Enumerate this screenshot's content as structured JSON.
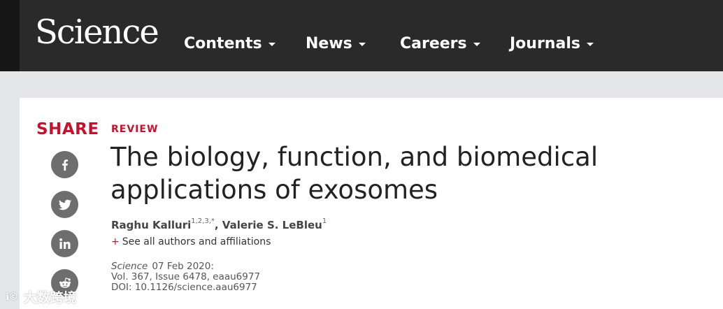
{
  "header": {
    "logo": "Science",
    "nav": [
      {
        "label": "Contents"
      },
      {
        "label": "News"
      },
      {
        "label": "Careers"
      },
      {
        "label": "Journals"
      }
    ]
  },
  "share": {
    "label": "SHARE",
    "buttons": [
      "facebook-icon",
      "twitter-icon",
      "linkedin-icon",
      "reddit-icon"
    ]
  },
  "article": {
    "type": "REVIEW",
    "title": "The biology, function, and biomedical applications of exosomes",
    "authors": [
      {
        "name": "Raghu Kalluri",
        "affiliations": "1,2,3,*",
        "separator": ", "
      },
      {
        "name": "Valerie S. LeBleu",
        "affiliations": "1",
        "separator": ""
      }
    ],
    "see_all_plus": "+",
    "see_all": "See all authors and affiliations",
    "journal": "Science",
    "date": "07 Feb 2020:",
    "volume": "Vol. 367, Issue 6478, eaau6977",
    "doi": "DOI: 10.1126/science.aau6977"
  },
  "watermark": {
    "logo": "ℹ©",
    "text": "大数跨境"
  },
  "colors": {
    "header_bg": "#2a2a2a",
    "accent_red": "#c4122f",
    "icon_gray": "#6e6e6e"
  }
}
